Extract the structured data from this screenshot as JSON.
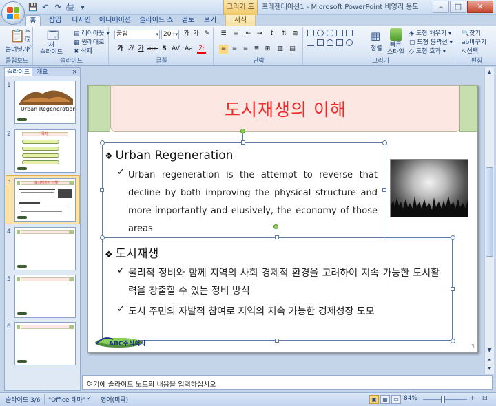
{
  "window": {
    "title": "프레젠테이션1 - Microsoft PowerPoint 비영리 용도",
    "context_tool": "그리기 도구",
    "controls": {
      "minimize": "–",
      "maximize": "□",
      "close": "✕"
    }
  },
  "qat": {
    "save": "💾",
    "undo": "↶",
    "redo": "↷",
    "print": "🖨",
    "more": "▾"
  },
  "tabs": [
    {
      "label": "홈",
      "active": true
    },
    {
      "label": "삽입"
    },
    {
      "label": "디자인"
    },
    {
      "label": "애니메이션"
    },
    {
      "label": "슬라이드 쇼"
    },
    {
      "label": "검토"
    },
    {
      "label": "보기"
    },
    {
      "label": "서식",
      "contextual": true
    }
  ],
  "ribbon": {
    "clipboard": {
      "label": "클립보드",
      "paste": "붙여넣기"
    },
    "slides": {
      "label": "슬라이드",
      "new_slide": "새\n슬라이드",
      "layout": "레이아웃",
      "reset": "원래대로",
      "delete": "삭제"
    },
    "font": {
      "label": "글꼴",
      "font_name": "굴림",
      "font_size": "20+",
      "row2": [
        "가",
        "가",
        "가",
        "abc",
        "S",
        "AV",
        "Aa",
        "가"
      ]
    },
    "paragraph": {
      "label": "단락"
    },
    "drawing": {
      "label": "그리기",
      "arrange": "정렬",
      "quick_styles": "빠른\n스타일",
      "fill": "도형 채우기",
      "outline": "도형 윤곽선",
      "effects": "도형 효과"
    },
    "editing": {
      "label": "편집",
      "find": "찾기",
      "replace": "바꾸기",
      "select": "선택"
    }
  },
  "left_panel": {
    "tabs": [
      {
        "label": "슬라이드",
        "active": true
      },
      {
        "label": "개요"
      }
    ],
    "close": "×",
    "thumbnails": [
      {
        "num": "1",
        "caption": "Urban Regeneration"
      },
      {
        "num": "2",
        "caption": "목차"
      },
      {
        "num": "3",
        "caption": "도시재생의 이해",
        "selected": true
      },
      {
        "num": "4"
      },
      {
        "num": "5"
      },
      {
        "num": "6"
      }
    ]
  },
  "slide": {
    "title": "도시재생의 이해",
    "section1": {
      "heading": "Urban Regeneration",
      "bullet": "Urban regeneration is the attempt to reverse that decline by both improving the physical structure and more importantly and elusively, the economy of those areas"
    },
    "section2": {
      "heading": "도시재생",
      "bullets": [
        "물리적 정비와 함께 지역의 사회 경제적 환경을 고려하여 지속 가능한 도시활력을 창출할 수 있는 정비 방식",
        "도시 주민의 자발적 참여로 지역의 지속 가능한 경제성장 도모"
      ]
    },
    "logo_text": "ABC주식회사",
    "page_number": "3",
    "symbols": {
      "diamond": "❖",
      "check": "✓"
    }
  },
  "notes": {
    "placeholder": "여기에 슬라이드 노트의 내용을 입력하십시오"
  },
  "status": {
    "slide_info": "슬라이드 3/6",
    "theme": "\"Office 테마\"",
    "language": "영어(미국)",
    "zoom": "84%",
    "zoom_minus": "–",
    "zoom_plus": "+"
  }
}
